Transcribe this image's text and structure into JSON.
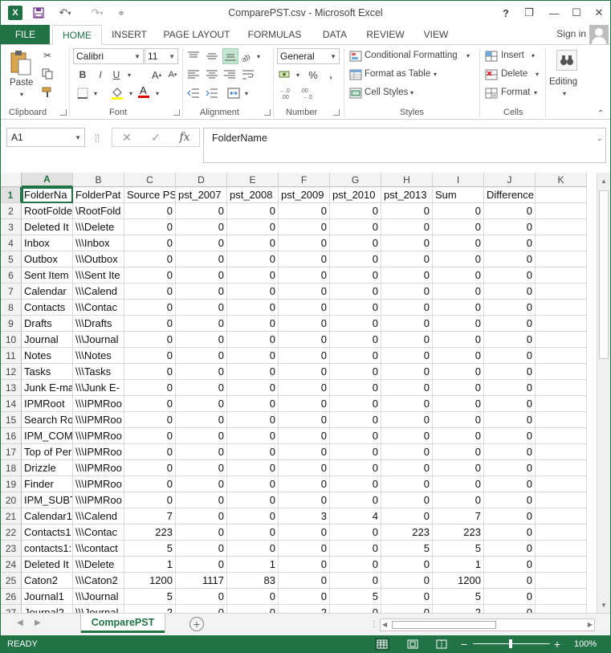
{
  "title": "ComparePST.csv - Microsoft Excel",
  "titlebar": {
    "help": "?",
    "minimize": "—",
    "restore": "❐",
    "close": "✕"
  },
  "tabs": [
    "FILE",
    "HOME",
    "INSERT",
    "PAGE LAYOUT",
    "FORMULAS",
    "DATA",
    "REVIEW",
    "VIEW"
  ],
  "active_tab": "HOME",
  "signin": "Sign in",
  "ribbon": {
    "clipboard": {
      "label": "Clipboard",
      "paste": "Paste"
    },
    "font": {
      "label": "Font",
      "name": "Calibri",
      "size": "11",
      "bold": "B",
      "italic": "I",
      "underline": "U"
    },
    "alignment": {
      "label": "Alignment"
    },
    "number": {
      "label": "Number",
      "format": "General",
      "percent": "%"
    },
    "styles": {
      "label": "Styles",
      "conditional": "Conditional Formatting",
      "format_table": "Format as Table",
      "cell_styles": "Cell Styles"
    },
    "cells": {
      "label": "Cells",
      "insert": "Insert",
      "delete": "Delete",
      "format": "Format"
    },
    "editing": {
      "label": "Editing"
    }
  },
  "formula_bar": {
    "name_box": "A1",
    "fx": "fx",
    "cancel": "✕",
    "enter": "✓",
    "content": "FolderName"
  },
  "columns": [
    "A",
    "B",
    "C",
    "D",
    "E",
    "F",
    "G",
    "H",
    "I",
    "J",
    "K"
  ],
  "rows": [
    [
      "FolderNa",
      "FolderPat",
      "Source PS",
      "pst_2007",
      "pst_2008",
      "pst_2009",
      "pst_2010",
      "pst_2013",
      "Sum",
      "Difference"
    ],
    [
      "RootFolde",
      "\\RootFold",
      "0",
      "0",
      "0",
      "0",
      "0",
      "0",
      "0",
      "0"
    ],
    [
      "Deleted It",
      "\\\\\\Delete",
      "0",
      "0",
      "0",
      "0",
      "0",
      "0",
      "0",
      "0"
    ],
    [
      "Inbox",
      "\\\\\\Inbox",
      "0",
      "0",
      "0",
      "0",
      "0",
      "0",
      "0",
      "0"
    ],
    [
      "Outbox",
      "\\\\\\Outbox",
      "0",
      "0",
      "0",
      "0",
      "0",
      "0",
      "0",
      "0"
    ],
    [
      "Sent Item",
      "\\\\\\Sent Ite",
      "0",
      "0",
      "0",
      "0",
      "0",
      "0",
      "0",
      "0"
    ],
    [
      "Calendar",
      "\\\\\\Calend",
      "0",
      "0",
      "0",
      "0",
      "0",
      "0",
      "0",
      "0"
    ],
    [
      "Contacts",
      "\\\\\\Contac",
      "0",
      "0",
      "0",
      "0",
      "0",
      "0",
      "0",
      "0"
    ],
    [
      "Drafts",
      "\\\\\\Drafts",
      "0",
      "0",
      "0",
      "0",
      "0",
      "0",
      "0",
      "0"
    ],
    [
      "Journal",
      "\\\\\\Journal",
      "0",
      "0",
      "0",
      "0",
      "0",
      "0",
      "0",
      "0"
    ],
    [
      "Notes",
      "\\\\\\Notes",
      "0",
      "0",
      "0",
      "0",
      "0",
      "0",
      "0",
      "0"
    ],
    [
      "Tasks",
      "\\\\\\Tasks",
      "0",
      "0",
      "0",
      "0",
      "0",
      "0",
      "0",
      "0"
    ],
    [
      "Junk E-ma",
      "\\\\\\Junk E-",
      "0",
      "0",
      "0",
      "0",
      "0",
      "0",
      "0",
      "0"
    ],
    [
      "IPMRoot",
      "\\\\\\IPMRoo",
      "0",
      "0",
      "0",
      "0",
      "0",
      "0",
      "0",
      "0"
    ],
    [
      "Search Ro",
      "\\\\\\IPMRoo",
      "0",
      "0",
      "0",
      "0",
      "0",
      "0",
      "0",
      "0"
    ],
    [
      "IPM_COM",
      "\\\\\\IPMRoo",
      "0",
      "0",
      "0",
      "0",
      "0",
      "0",
      "0",
      "0"
    ],
    [
      "Top of Per",
      "\\\\\\IPMRoo",
      "0",
      "0",
      "0",
      "0",
      "0",
      "0",
      "0",
      "0"
    ],
    [
      "Drizzle",
      "\\\\\\IPMRoo",
      "0",
      "0",
      "0",
      "0",
      "0",
      "0",
      "0",
      "0"
    ],
    [
      "Finder",
      "\\\\\\IPMRoo",
      "0",
      "0",
      "0",
      "0",
      "0",
      "0",
      "0",
      "0"
    ],
    [
      "IPM_SUBT",
      "\\\\\\IPMRoo",
      "0",
      "0",
      "0",
      "0",
      "0",
      "0",
      "0",
      "0"
    ],
    [
      "Calendar1",
      "\\\\\\Calend",
      "7",
      "0",
      "0",
      "3",
      "4",
      "0",
      "7",
      "0"
    ],
    [
      "Contacts1",
      "\\\\\\Contac",
      "223",
      "0",
      "0",
      "0",
      "0",
      "223",
      "223",
      "0"
    ],
    [
      "contacts1:",
      "\\\\\\contact",
      "5",
      "0",
      "0",
      "0",
      "0",
      "5",
      "5",
      "0"
    ],
    [
      "Deleted It",
      "\\\\\\Delete",
      "1",
      "0",
      "1",
      "0",
      "0",
      "0",
      "1",
      "0"
    ],
    [
      "Caton2",
      "\\\\\\Caton2",
      "1200",
      "1117",
      "83",
      "0",
      "0",
      "0",
      "1200",
      "0"
    ],
    [
      "Journal1",
      "\\\\\\Journal",
      "5",
      "0",
      "0",
      "0",
      "5",
      "0",
      "5",
      "0"
    ],
    [
      "Journal2",
      "\\\\\\Journal",
      "2",
      "0",
      "0",
      "2",
      "0",
      "0",
      "2",
      "0"
    ]
  ],
  "sheet_tab": "ComparePST",
  "status": {
    "ready": "READY",
    "zoom": "100%",
    "minus": "−",
    "plus": "+"
  }
}
